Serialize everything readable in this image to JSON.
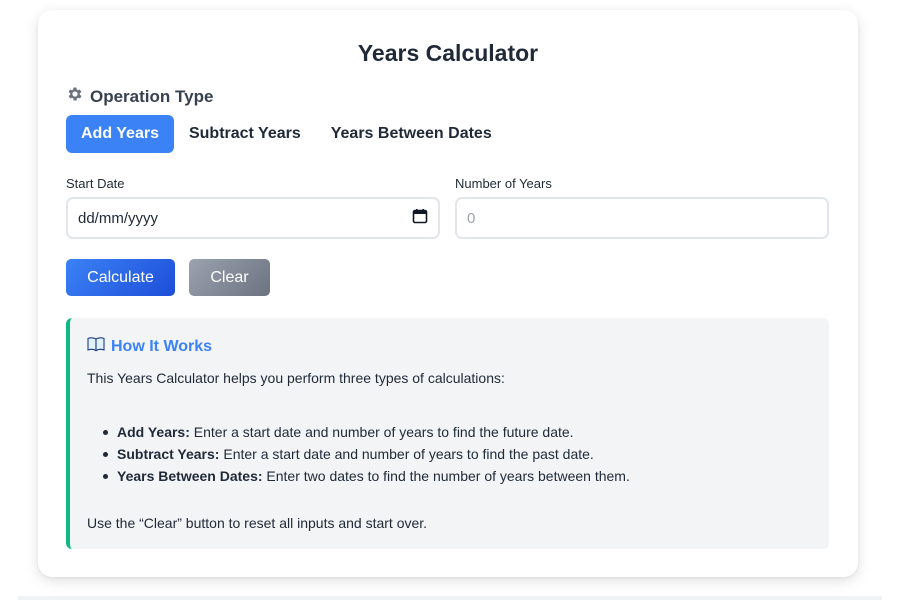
{
  "title": "Years Calculator",
  "operation": {
    "heading": "Operation Type",
    "tabs": [
      {
        "label": "Add Years",
        "active": true
      },
      {
        "label": "Subtract Years",
        "active": false
      },
      {
        "label": "Years Between Dates",
        "active": false
      }
    ]
  },
  "form": {
    "start_date": {
      "label": "Start Date",
      "placeholder": "dd/mm/yyyy"
    },
    "num_years": {
      "label": "Number of Years",
      "placeholder": "0"
    }
  },
  "buttons": {
    "calculate": "Calculate",
    "clear": "Clear"
  },
  "info": {
    "title": "How It Works",
    "intro": "This Years Calculator helps you perform three types of calculations:",
    "items": [
      {
        "term": "Add Years:",
        "desc": " Enter a start date and number of years to find the future date."
      },
      {
        "term": "Subtract Years:",
        "desc": " Enter a start date and number of years to find the past date."
      },
      {
        "term": "Years Between Dates:",
        "desc": " Enter two dates to find the number of years between them."
      }
    ],
    "outro": "Use the “Clear” button to reset all inputs and start over."
  },
  "colors": {
    "accent": "#3b82f6",
    "info_border": "#10b981",
    "clear_button": "#9ca3af"
  },
  "icons": {
    "operation": "gear-icon",
    "date_picker": "calendar-icon",
    "info": "book-icon"
  }
}
